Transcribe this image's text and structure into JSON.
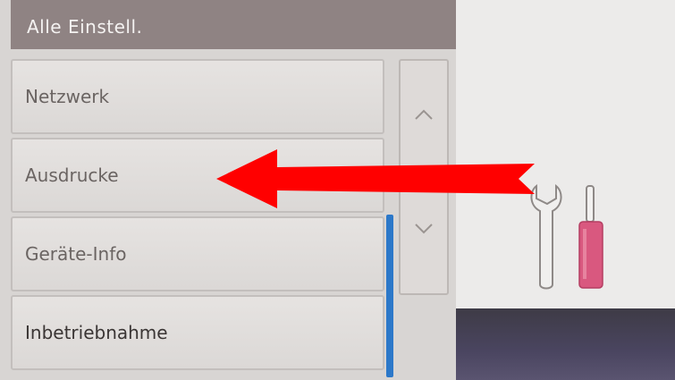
{
  "header": {
    "title": "Alle Einstell."
  },
  "menu": {
    "items": [
      {
        "label": "Netzwerk"
      },
      {
        "label": "Ausdrucke"
      },
      {
        "label": "Geräte-Info"
      },
      {
        "label": "Inbetriebnahme"
      }
    ]
  },
  "icons": {
    "scroll_up": "chevron-up-icon",
    "scroll_down": "chevron-down-icon",
    "tools": "wrench-screwdriver-icon",
    "annotation": "red-arrow-icon"
  },
  "colors": {
    "header_bg": "#8f8383",
    "scroll_thumb": "#2c78c9",
    "screwdriver_handle": "#d9587f",
    "annotation_arrow": "#ff0000"
  }
}
